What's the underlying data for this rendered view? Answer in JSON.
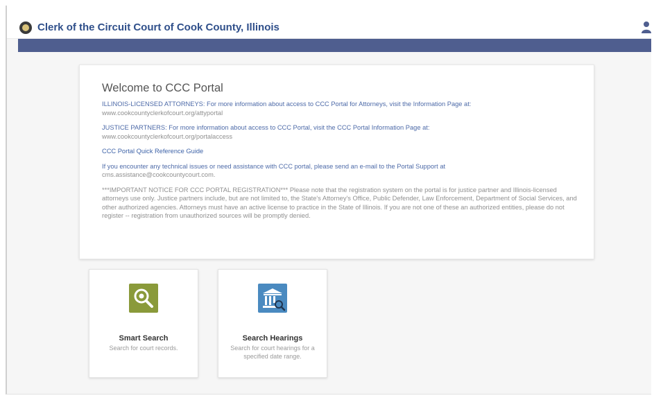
{
  "header": {
    "title": "Clerk of the Circuit Court of Cook County, Illinois",
    "seal_icon": "county-seal-icon",
    "user_icon": "user-icon"
  },
  "colors": {
    "nav_bar": "#4f5e8f",
    "title_text": "#2f4f8a",
    "link": "#3e63a8",
    "smart_search_tile": "#8a9a3a",
    "hearings_tile": "#4a8ac0"
  },
  "welcome": {
    "title": "Welcome to CCC Portal",
    "attorneys": {
      "label": "ILLINOIS-LICENSED ATTORNEYS:",
      "text": " For more information about access to CCC Portal for Attorneys, visit the Information Page at:",
      "url": "www.cookcountyclerkofcourt.org/attyportal"
    },
    "partners": {
      "label": "JUSTICE PARTNERS:",
      "text": " For more information about access to CCC Portal, visit the CCC Portal Information Page at:",
      "url": "www.cookcountyclerkofcourt.org/portalaccess"
    },
    "quick_ref": "CCC Portal Quick Reference Guide",
    "support": {
      "text": "If you encounter any technical issues or need assistance with CCC portal, please send an e-mail to the Portal Support at",
      "email": "cms.assistance@cookcountycourt.com."
    },
    "notice": "***IMPORTANT NOTICE FOR CCC PORTAL REGISTRATION*** Please note that the registration system on the portal is for justice partner and Illinois-licensed attorneys use only. Justice partners include, but are not limited to, the State's Attorney's Office, Public Defender, Law Enforcement, Department of Social Services, and other authorized agencies. Attorneys must have an active license to practice in the State of Illinois. If you are not one of these an authorized entities, please do not register -- registration from unauthorized sources will be promptly denied."
  },
  "tiles": [
    {
      "icon": "magnifier-icon",
      "label": "Smart Search",
      "description": "Search for court records."
    },
    {
      "icon": "courthouse-search-icon",
      "label": "Search Hearings",
      "description": "Search for court hearings for a specified date range."
    }
  ]
}
